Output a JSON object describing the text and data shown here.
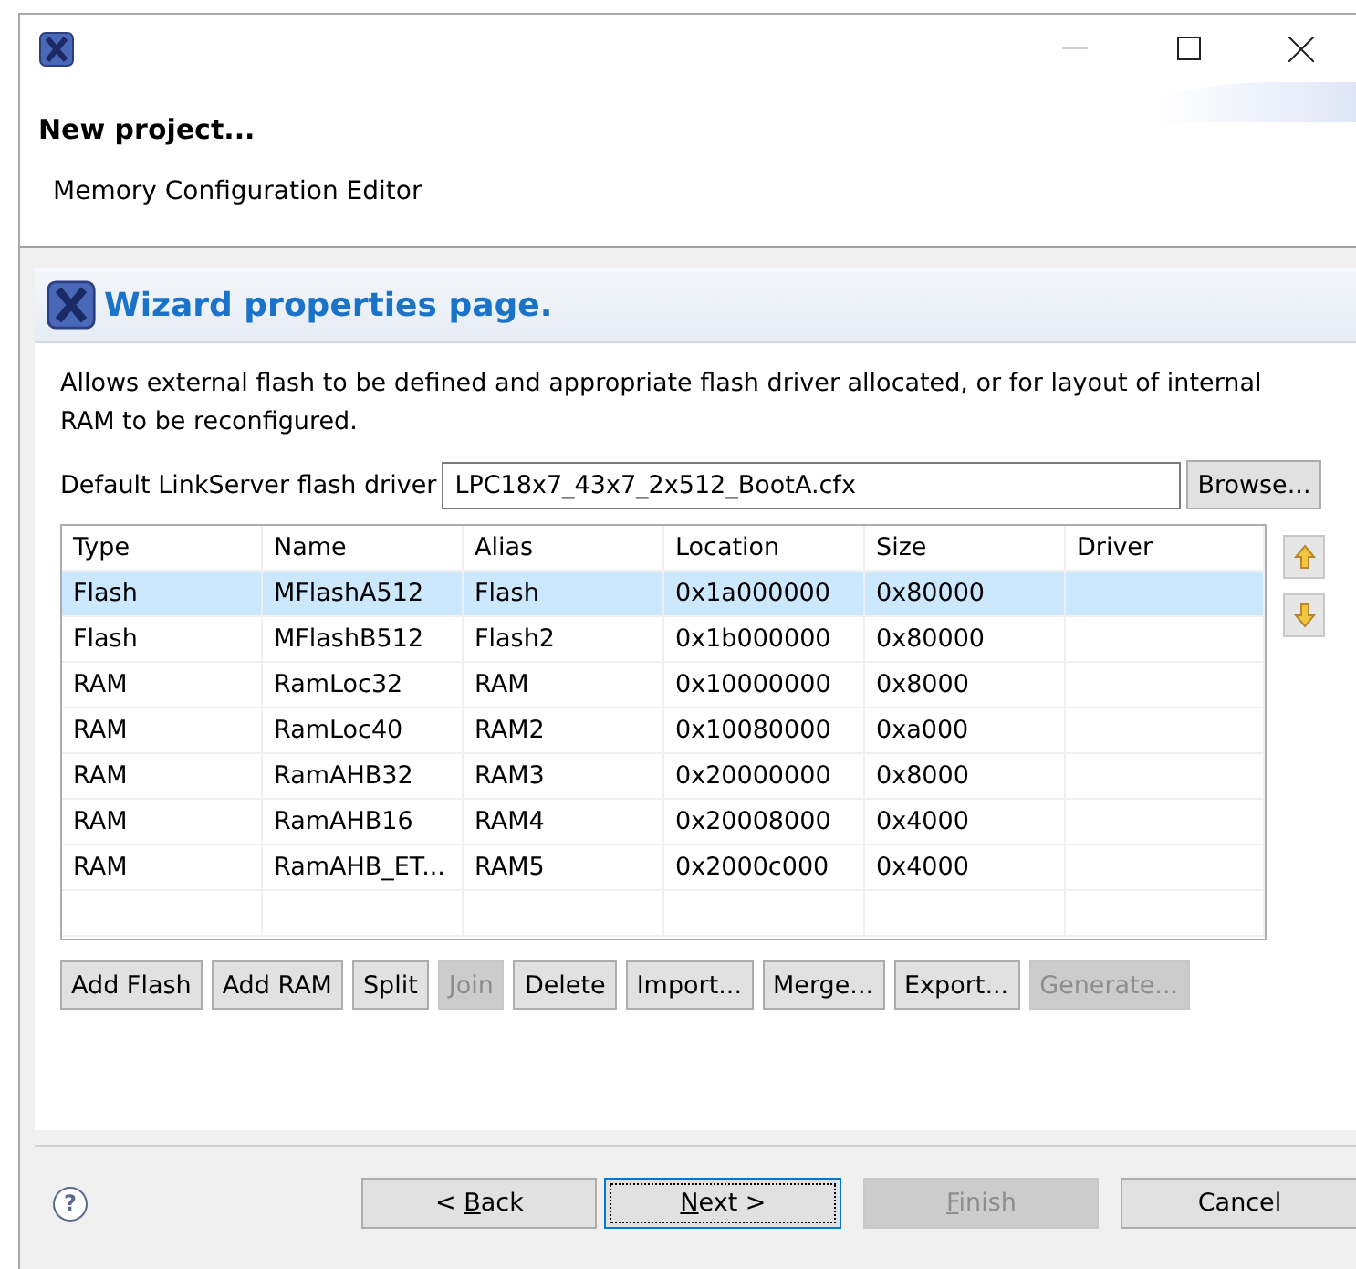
{
  "window": {
    "title_controls": [
      {
        "kind": "minimize"
      },
      {
        "kind": "maximize"
      },
      {
        "kind": "close"
      }
    ]
  },
  "header": {
    "title": "New project...",
    "subtitle": "Memory Configuration Editor"
  },
  "page": {
    "title": "Wizard properties page.",
    "description": "Allows external flash to be defined and appropriate flash driver allocated, or for layout of internal RAM to be reconfigured."
  },
  "driver": {
    "label": "Default LinkServer flash driver",
    "value": "LPC18x7_43x7_2x512_BootA.cfx",
    "button": "Browse..."
  },
  "table": {
    "columns": [
      "Type",
      "Name",
      "Alias",
      "Location",
      "Size",
      "Driver"
    ],
    "rows": [
      {
        "cells": [
          "Flash",
          "MFlashA512",
          "Flash",
          "0x1a000000",
          "0x80000",
          ""
        ],
        "selected": true
      },
      {
        "cells": [
          "Flash",
          "MFlashB512",
          "Flash2",
          "0x1b000000",
          "0x80000",
          ""
        ],
        "selected": false
      },
      {
        "cells": [
          "RAM",
          "RamLoc32",
          "RAM",
          "0x10000000",
          "0x8000",
          ""
        ],
        "selected": false
      },
      {
        "cells": [
          "RAM",
          "RamLoc40",
          "RAM2",
          "0x10080000",
          "0xa000",
          ""
        ],
        "selected": false
      },
      {
        "cells": [
          "RAM",
          "RamAHB32",
          "RAM3",
          "0x20000000",
          "0x8000",
          ""
        ],
        "selected": false
      },
      {
        "cells": [
          "RAM",
          "RamAHB16",
          "RAM4",
          "0x20008000",
          "0x4000",
          ""
        ],
        "selected": false
      },
      {
        "cells": [
          "RAM",
          "RamAHB_ET...",
          "RAM5",
          "0x2000c000",
          "0x4000",
          ""
        ],
        "selected": false
      }
    ]
  },
  "side_buttons": [
    {
      "kind": "up"
    },
    {
      "kind": "down"
    }
  ],
  "actions": [
    {
      "label": "Add Flash",
      "disabled": false
    },
    {
      "label": "Add RAM",
      "disabled": false
    },
    {
      "label": "Split",
      "disabled": false
    },
    {
      "label": "Join",
      "disabled": true
    },
    {
      "label": "Delete",
      "disabled": false
    },
    {
      "label": "Import...",
      "disabled": false
    },
    {
      "label": "Merge...",
      "disabled": false
    },
    {
      "label": "Export...",
      "disabled": false
    },
    {
      "label": "Generate...",
      "disabled": true
    }
  ],
  "footer": {
    "help": "?",
    "buttons": [
      {
        "pre": "< ",
        "key": "B",
        "post": "ack",
        "disabled": false,
        "focused": false
      },
      {
        "key": "N",
        "post": "ext >",
        "disabled": false,
        "focused": true
      },
      {
        "key": "F",
        "post": "inish",
        "disabled": true,
        "focused": false
      },
      {
        "pre": "Cancel",
        "disabled": false,
        "focused": false
      }
    ]
  }
}
